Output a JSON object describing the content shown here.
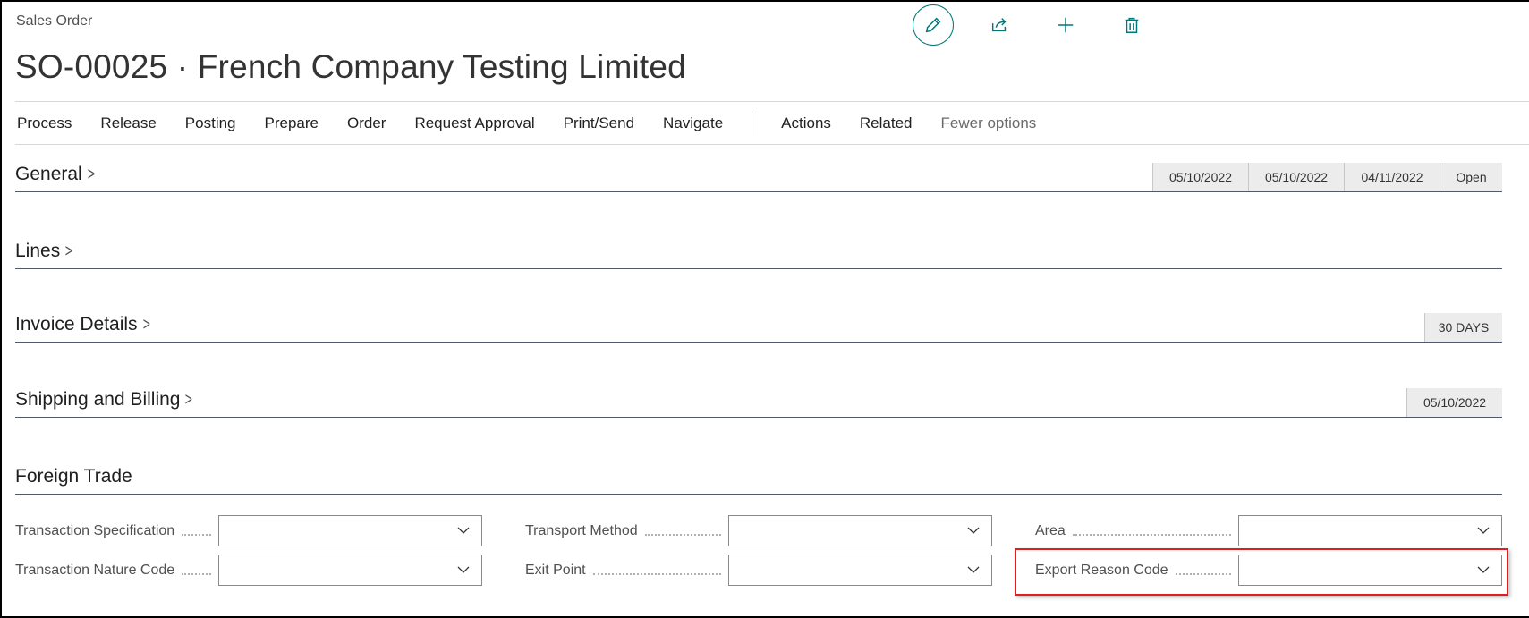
{
  "page": {
    "breadcrumb": "Sales Order",
    "title": "SO-00025 · French Company Testing Limited"
  },
  "top_actions": [
    {
      "name": "edit-icon"
    },
    {
      "name": "share-icon"
    },
    {
      "name": "plus-icon"
    },
    {
      "name": "delete-icon"
    }
  ],
  "menu": {
    "items": [
      "Process",
      "Release",
      "Posting",
      "Prepare",
      "Order",
      "Request Approval",
      "Print/Send",
      "Navigate"
    ],
    "items2": [
      "Actions",
      "Related"
    ],
    "fewer": "Fewer options"
  },
  "sections": {
    "general": {
      "title": "General",
      "pills": [
        "05/10/2022",
        "05/10/2022",
        "04/11/2022",
        "Open"
      ]
    },
    "lines": {
      "title": "Lines"
    },
    "invoice": {
      "title": "Invoice Details",
      "pills": [
        "30 DAYS"
      ]
    },
    "shipping": {
      "title": "Shipping and Billing",
      "pills": [
        "05/10/2022"
      ]
    },
    "foreign": {
      "title": "Foreign Trade"
    }
  },
  "fields": {
    "transaction_specification": {
      "label": "Transaction Specification",
      "value": ""
    },
    "transaction_nature_code": {
      "label": "Transaction Nature Code",
      "value": ""
    },
    "transport_method": {
      "label": "Transport Method",
      "value": ""
    },
    "exit_point": {
      "label": "Exit Point",
      "value": ""
    },
    "area": {
      "label": "Area",
      "value": ""
    },
    "export_reason_code": {
      "label": "Export Reason Code",
      "value": ""
    }
  },
  "colors": {
    "accent": "#00787a",
    "highlight": "#e01e1e"
  }
}
